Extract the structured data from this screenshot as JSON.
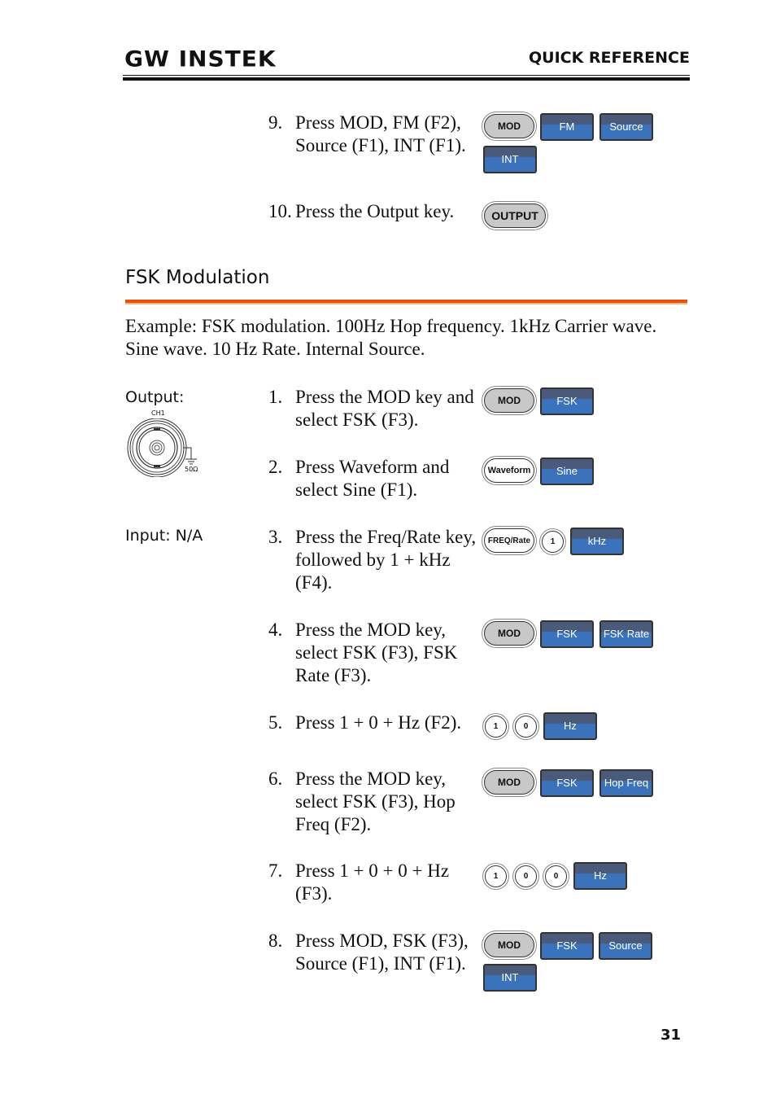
{
  "header": {
    "logo": "GW INSTEK",
    "section_label": "QUICK REFERENCE"
  },
  "prev_steps": [
    {
      "num": "9.",
      "text": "Press MOD, FM (F2), Source (F1), INT (F1).",
      "keys": [
        "MOD",
        "FM",
        "Source",
        "INT"
      ]
    },
    {
      "num": "10.",
      "text": "Press the Output key.",
      "keys": [
        "OUTPUT"
      ]
    }
  ],
  "section": {
    "title": "FSK Modulation",
    "intro": "Example: FSK modulation. 100Hz Hop frequency. 1kHz Carrier wave. Sine wave. 10 Hz Rate. Internal Source.",
    "output_label": "Output:",
    "input_label": "Input: N/A",
    "connector": {
      "channel": "CH1",
      "impedance": "50Ω"
    },
    "steps": [
      {
        "num": "1.",
        "text": "Press the MOD key and select FSK (F3).",
        "keys": [
          "MOD",
          "FSK"
        ]
      },
      {
        "num": "2.",
        "text": "Press Waveform and select Sine (F1).",
        "keys": [
          "Waveform",
          "Sine"
        ]
      },
      {
        "num": "3.",
        "text": "Press the Freq/Rate key, followed by 1 + kHz (F4).",
        "keys": [
          "FREQ/Rate",
          "1",
          "kHz"
        ]
      },
      {
        "num": "4.",
        "text": "Press the MOD key, select FSK (F3), FSK Rate (F3).",
        "keys": [
          "MOD",
          "FSK",
          "FSK Rate"
        ]
      },
      {
        "num": "5.",
        "text": "Press 1 + 0 + Hz (F2).",
        "keys": [
          "1",
          "0",
          "Hz"
        ]
      },
      {
        "num": "6.",
        "text": "Press the MOD key, select FSK (F3), Hop Freq (F2).",
        "keys": [
          "MOD",
          "FSK",
          "Hop Freq"
        ]
      },
      {
        "num": "7.",
        "text": "Press 1 + 0 + 0 + Hz (F3).",
        "keys": [
          "1",
          "0",
          "0",
          "Hz"
        ]
      },
      {
        "num": "8.",
        "text": "Press MOD, FSK (F3), Source (F1), INT (F1).",
        "keys": [
          "MOD",
          "FSK",
          "Source",
          "INT"
        ]
      }
    ]
  },
  "footer": {
    "page_number": "31"
  },
  "colors": {
    "accent": "#e8500f",
    "softkey": "#3a72bb",
    "softkey_top": "#4a5a7a"
  }
}
